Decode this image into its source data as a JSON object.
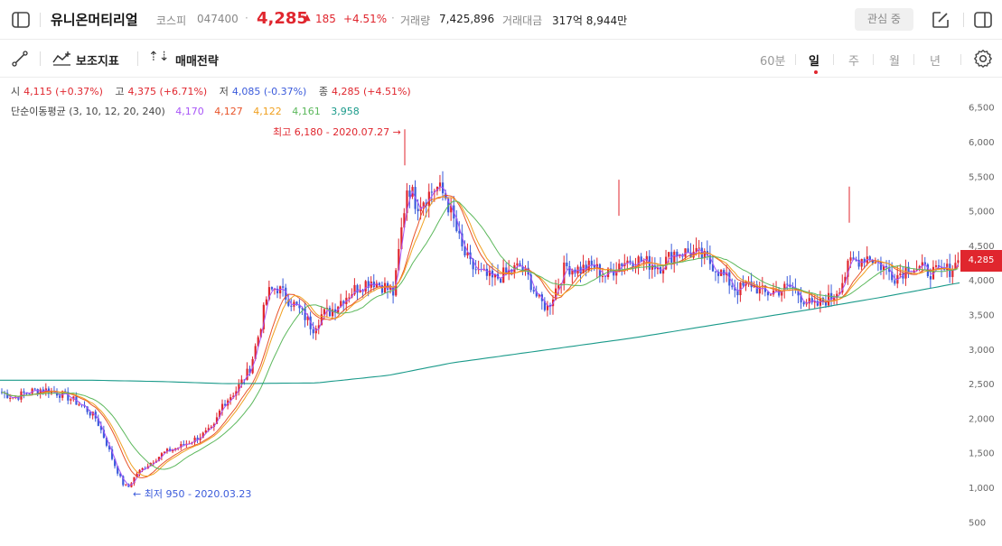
{
  "header": {
    "stock_name": "유니온머티리얼",
    "market": "코스피",
    "code": "047400",
    "separator": "·",
    "price": "4,285",
    "change_arrow": "▲",
    "change": "185",
    "change_pct": "+4.51%",
    "volume_label": "거래량",
    "volume": "7,425,896",
    "amount_label": "거래대금",
    "amount": "317억 8,944만",
    "watch_label": "관심 중"
  },
  "toolbar": {
    "indicator_label": "보조지표",
    "strategy_label": "매매전략",
    "periods": [
      "60분",
      "일",
      "주",
      "월",
      "년"
    ],
    "active_period": "일"
  },
  "ohlc": {
    "open_label": "시",
    "open": "4,115 (+0.37%)",
    "high_label": "고",
    "high": "4,375 (+6.71%)",
    "low_label": "저",
    "low": "4,085 (-0.37%)",
    "close_label": "종",
    "close": "4,285 (+4.51%)"
  },
  "ma_legend": {
    "label": "단순이동평균 (3, 10, 12, 20, 240)",
    "values": [
      "4,170",
      "4,127",
      "4,122",
      "4,161",
      "3,958"
    ]
  },
  "colors": {
    "up": "#e0262e",
    "down": "#3b5bdb",
    "ma3": "#a855f7",
    "ma10": "#e8542a",
    "ma12": "#f0a020",
    "ma20": "#5cb85c",
    "ma240": "#1a9a8a"
  },
  "chart_data": {
    "type": "candlestick",
    "y_ticks": [
      "6,500",
      "6,000",
      "5,500",
      "5,000",
      "4,500",
      "4,000",
      "3,500",
      "3,000",
      "2,500",
      "2,000",
      "1,500",
      "1,000",
      "500"
    ],
    "ylim": [
      300,
      6800
    ],
    "high_annotation": "최고 6,180 - 2020.07.27 →",
    "low_annotation": "← 최저 950 - 2020.03.23",
    "last_price_tag": "4,285",
    "anchors": [
      [
        0,
        2380
      ],
      [
        15,
        2300
      ],
      [
        30,
        2380
      ],
      [
        45,
        2420
      ],
      [
        60,
        2380
      ],
      [
        75,
        2300
      ],
      [
        90,
        2180
      ],
      [
        105,
        2000
      ],
      [
        115,
        1700
      ],
      [
        125,
        1350
      ],
      [
        135,
        1050
      ],
      [
        141,
        1000
      ],
      [
        150,
        1200
      ],
      [
        165,
        1350
      ],
      [
        180,
        1500
      ],
      [
        200,
        1600
      ],
      [
        215,
        1700
      ],
      [
        235,
        1850
      ],
      [
        245,
        2200
      ],
      [
        260,
        2400
      ],
      [
        275,
        2700
      ],
      [
        285,
        3200
      ],
      [
        295,
        3800
      ],
      [
        305,
        3900
      ],
      [
        320,
        3700
      ],
      [
        335,
        3500
      ],
      [
        345,
        3300
      ],
      [
        355,
        3500
      ],
      [
        365,
        3550
      ],
      [
        380,
        3750
      ],
      [
        395,
        3900
      ],
      [
        410,
        4000
      ],
      [
        425,
        3900
      ],
      [
        435,
        3800
      ],
      [
        442,
        4600
      ],
      [
        450,
        5400
      ],
      [
        460,
        5100
      ],
      [
        470,
        5200
      ],
      [
        482,
        5350
      ],
      [
        492,
        5200
      ],
      [
        500,
        4900
      ],
      [
        510,
        4450
      ],
      [
        520,
        4200
      ],
      [
        530,
        4100
      ],
      [
        545,
        4000
      ],
      [
        560,
        4100
      ],
      [
        575,
        4200
      ],
      [
        585,
        4000
      ],
      [
        595,
        3700
      ],
      [
        605,
        3600
      ],
      [
        615,
        3900
      ],
      [
        625,
        4200
      ],
      [
        640,
        4150
      ],
      [
        655,
        4200
      ],
      [
        670,
        4050
      ],
      [
        685,
        4250
      ],
      [
        700,
        4300
      ],
      [
        715,
        4250
      ],
      [
        730,
        4200
      ],
      [
        745,
        4400
      ],
      [
        760,
        4400
      ],
      [
        775,
        4350
      ],
      [
        790,
        4200
      ],
      [
        800,
        4050
      ],
      [
        815,
        3850
      ],
      [
        830,
        3950
      ],
      [
        845,
        3800
      ],
      [
        860,
        3850
      ],
      [
        875,
        3900
      ],
      [
        890,
        3700
      ],
      [
        900,
        3600
      ],
      [
        910,
        3700
      ],
      [
        920,
        3750
      ],
      [
        930,
        3950
      ],
      [
        940,
        4250
      ],
      [
        950,
        4300
      ],
      [
        960,
        4350
      ],
      [
        975,
        4200
      ],
      [
        990,
        4050
      ],
      [
        1005,
        4200
      ],
      [
        1020,
        4150
      ],
      [
        1035,
        4100
      ],
      [
        1050,
        4150
      ],
      [
        1062,
        4285
      ]
    ],
    "ma240_anchors": [
      [
        0,
        2550
      ],
      [
        100,
        2550
      ],
      [
        180,
        2530
      ],
      [
        250,
        2500
      ],
      [
        350,
        2510
      ],
      [
        430,
        2620
      ],
      [
        500,
        2800
      ],
      [
        600,
        2980
      ],
      [
        700,
        3160
      ],
      [
        800,
        3370
      ],
      [
        900,
        3580
      ],
      [
        980,
        3760
      ],
      [
        1062,
        3958
      ]
    ]
  }
}
